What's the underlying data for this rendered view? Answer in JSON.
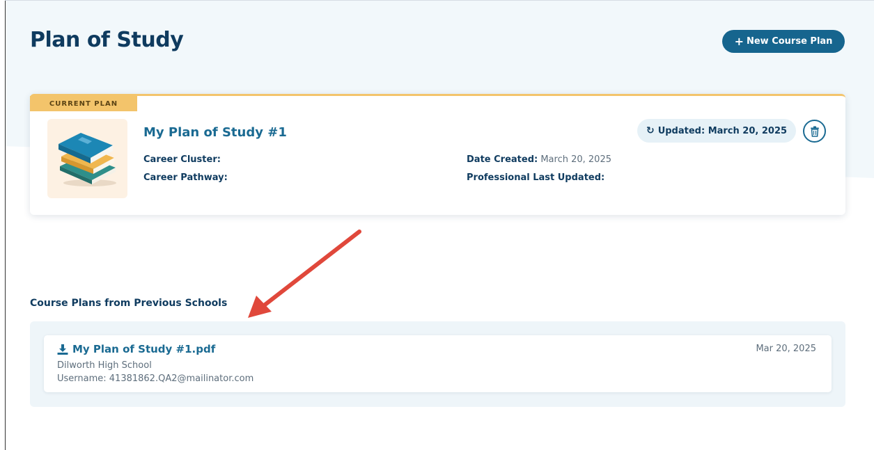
{
  "page": {
    "title": "Plan of Study",
    "new_plan_button": "New Course Plan",
    "new_plan_icon": "plus-icon"
  },
  "current_plan": {
    "tag": "CURRENT PLAN",
    "thumbnail_icon": "stacked-books-icon",
    "name": "My Plan of Study #1",
    "updated_label": "Updated: March 20, 2025",
    "updated_icon": "refresh-icon",
    "delete_icon": "trash-icon",
    "career_cluster_label": "Career Cluster:",
    "career_cluster_value": "",
    "career_pathway_label": "Career Pathway:",
    "career_pathway_value": "",
    "date_created_label": "Date Created:",
    "date_created_value": "March 20, 2025",
    "prof_updated_label": "Professional Last Updated:",
    "prof_updated_value": ""
  },
  "previous": {
    "section_title": "Course Plans from Previous Schools",
    "items": [
      {
        "file_name": "My Plan of Study #1.pdf",
        "download_icon": "download-icon",
        "school": "Dilworth High School",
        "username": "Username: 41381862.QA2@mailinator.com",
        "date": "Mar 20, 2025"
      }
    ]
  },
  "annotation": {
    "arrow_icon": "red-arrow-icon",
    "color": "#e0483b"
  },
  "colors": {
    "primary": "#16658e",
    "heading": "#0f3b5f",
    "accent_gold": "#f3c46b"
  }
}
